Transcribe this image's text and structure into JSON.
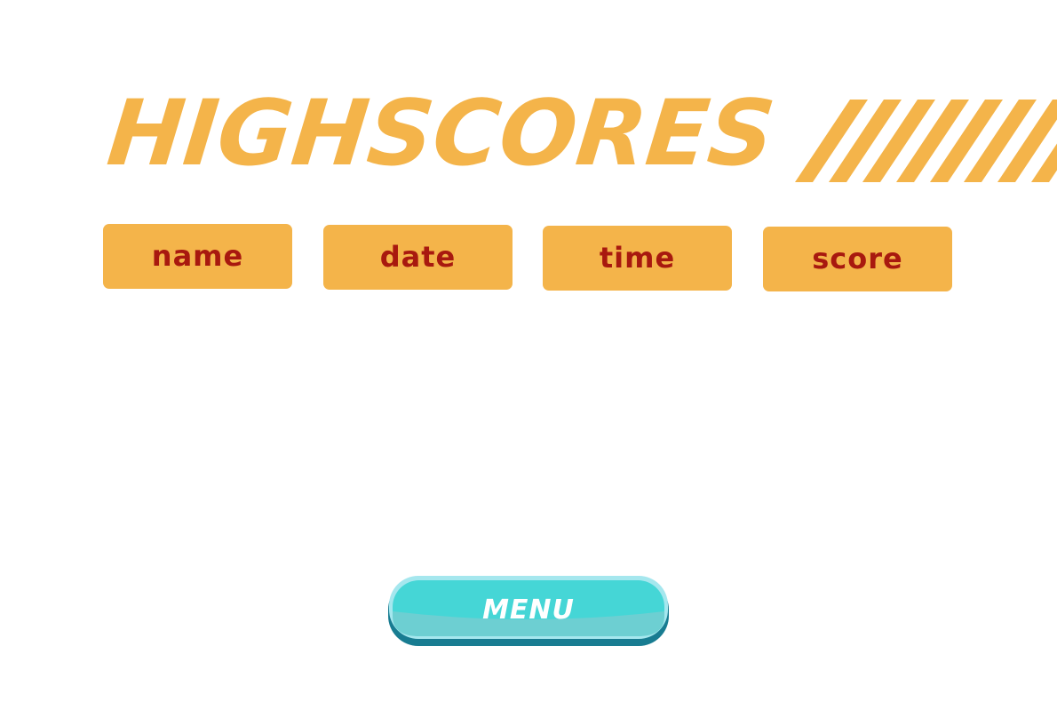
{
  "title": "HIGHSCORES",
  "columns": {
    "name": "name",
    "date": "date",
    "time": "time",
    "score": "score"
  },
  "menu_label": "MENU",
  "colors": {
    "accent": "#f4b44a",
    "header_text": "#a8190f",
    "menu_button": "#45d6d6"
  }
}
